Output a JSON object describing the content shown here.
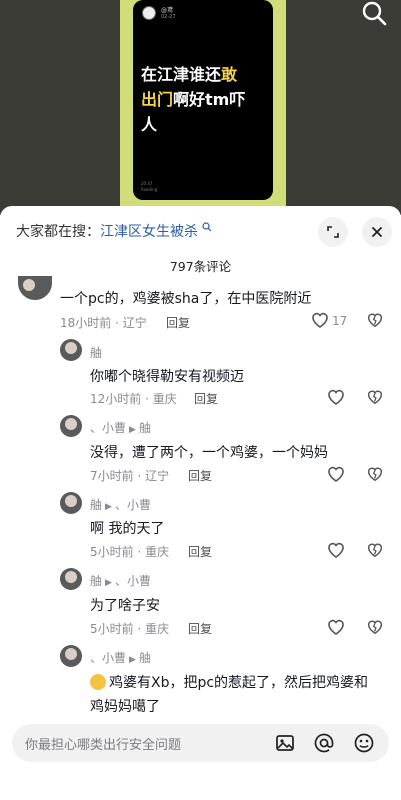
{
  "video": {
    "author": "@鸢",
    "date": "02-27",
    "headline_line1_a": "在江津谁还",
    "headline_line1_b": "敢",
    "headline_line2_a": "出门",
    "headline_line2_b": "啊好tm吓",
    "headline_line3": "人",
    "footer_line1": "20:47",
    "footer_line2": "Reading",
    "colors": {
      "strip": "#d2dc78",
      "highlight": "#f5d24b"
    }
  },
  "search": {
    "icon": "search-icon"
  },
  "sheet": {
    "hot_search_label": "大家都在搜：",
    "hot_search_term": "江津区女生被杀",
    "comment_count": "797条评论",
    "expand_icon": "expand-icon",
    "close_icon": "close-icon"
  },
  "comments": [
    {
      "name": "",
      "text": "一个pc的，鸡婆被sha了，在中医院附近",
      "time": "18小时前 · 辽宁",
      "reply": "回复",
      "likes": "17"
    },
    {
      "name": "舳",
      "text": "你嘟个晓得勒安有视频迈",
      "time": "12小时前 · 重庆",
      "reply": "回复",
      "likes": ""
    },
    {
      "name": "、小曹",
      "target": "舳",
      "text": "没得，遭了两个，一个鸡婆，一个妈妈",
      "time": "7小时前 · 辽宁",
      "reply": "回复",
      "likes": ""
    },
    {
      "name": "舳",
      "target": "、小曹",
      "text": "啊  我的天了",
      "time": "5小时前 · 重庆",
      "reply": "回复",
      "likes": ""
    },
    {
      "name": "舳",
      "target": "、小曹",
      "text": "为了啥子安",
      "time": "5小时前 · 重庆",
      "reply": "回复",
      "likes": ""
    },
    {
      "name": "、小曹",
      "target": "舳",
      "text_line1": "鸡婆有Xb，把pc的惹起了，然后把鸡婆和",
      "text_line2": "鸡妈妈噶了"
    }
  ],
  "input": {
    "placeholder": "你最担心哪类出行安全问题",
    "icons": [
      "image-icon",
      "mention-icon",
      "emoji-icon"
    ]
  }
}
